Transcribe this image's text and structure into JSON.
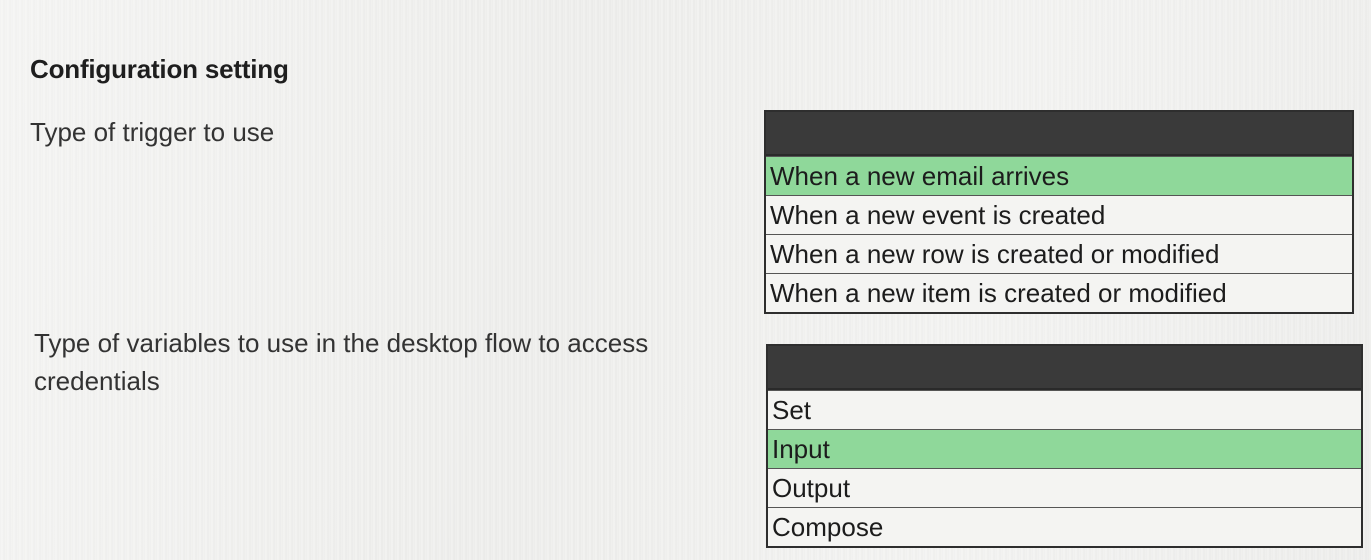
{
  "heading": "Configuration setting",
  "questions": [
    {
      "label": "Type of trigger to use",
      "options": [
        "When a new email arrives",
        "When a new event is created",
        "When a new row is created or modified",
        "When a new item is created or modified"
      ],
      "selected_index": 0
    },
    {
      "label": "Type of variables to use in the desktop flow to access credentials",
      "options": [
        "Set",
        "Input",
        "Output",
        "Compose"
      ],
      "selected_index": 1
    }
  ],
  "colors": {
    "selected": "#8fd89a",
    "header": "#3a3a3a"
  }
}
